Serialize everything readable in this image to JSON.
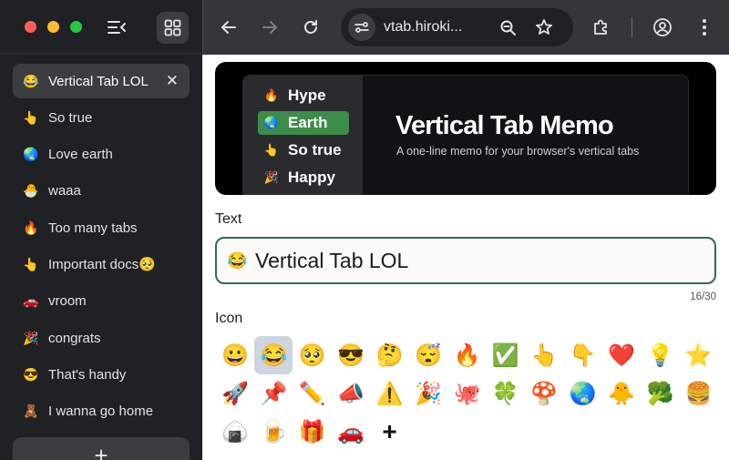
{
  "sidebar": {
    "tabs": [
      {
        "emoji": "😂",
        "label": "Vertical Tab LOL",
        "active": true
      },
      {
        "emoji": "👆",
        "label": "So true"
      },
      {
        "emoji": "🌏",
        "label": "Love earth"
      },
      {
        "emoji": "🐣",
        "label": "waaa"
      },
      {
        "emoji": "🔥",
        "label": "Too many tabs"
      },
      {
        "emoji": "👆",
        "label": "Important docs🥺"
      },
      {
        "emoji": "🚗",
        "label": "vroom"
      },
      {
        "emoji": "🎉",
        "label": "congrats"
      },
      {
        "emoji": "😎",
        "label": "That's handy"
      },
      {
        "emoji": "🧸",
        "label": "I wanna go home"
      }
    ],
    "close_glyph": "✕",
    "new_tab_glyph": "+"
  },
  "toolbar": {
    "url": "vtab.hiroki...",
    "icons": [
      "back-arrow-icon",
      "forward-arrow-icon",
      "reload-icon",
      "site-info-icon",
      "search-icon",
      "star-icon",
      "extensions-icon",
      "profile-icon",
      "more-menu-icon"
    ]
  },
  "banner": {
    "title": "Vertical Tab Memo",
    "subtitle": "A one-line memo for your browser's vertical tabs",
    "items": [
      {
        "emoji": "🔥",
        "label": "Hype"
      },
      {
        "emoji": "🌏",
        "label": "Earth",
        "active": true
      },
      {
        "emoji": "👆",
        "label": "So true"
      },
      {
        "emoji": "🎉",
        "label": "Happy"
      }
    ],
    "accent": "#3d8c4a"
  },
  "form": {
    "text_label": "Text",
    "text_emoji": "😂",
    "text_value": "Vertical Tab LOL",
    "counter": "16/30",
    "icon_label": "Icon",
    "field_border_color": "#2e6b55"
  },
  "icons": {
    "emojis": [
      "😀",
      "😂",
      "🥺",
      "😎",
      "🤔",
      "😴",
      "🔥",
      "✅",
      "👆",
      "👇",
      "❤️",
      "💡",
      "⭐",
      "🚀",
      "📌",
      "✏️",
      "📣",
      "⚠️",
      "🎉",
      "🐙",
      "🍀",
      "🍄",
      "🌏",
      "🐥",
      "🥦",
      "🍔",
      "🍙",
      "🍺",
      "🎁",
      "🚗"
    ],
    "selected": 1,
    "add_glyph": "+"
  }
}
